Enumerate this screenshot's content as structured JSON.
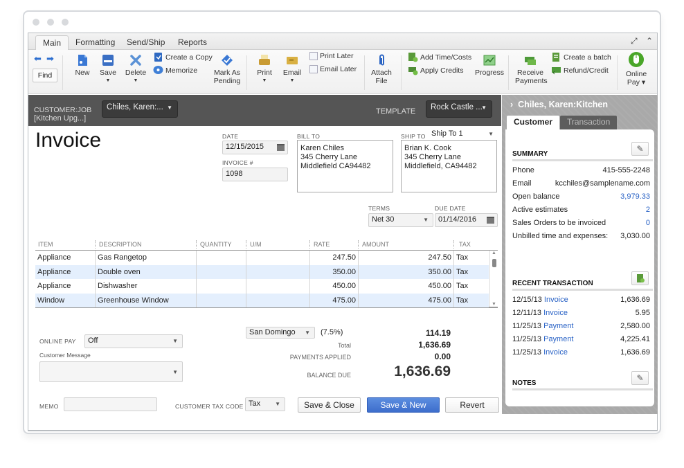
{
  "window": {
    "controls": [
      "close",
      "minimize",
      "maximize"
    ]
  },
  "tabs": [
    {
      "label": "Main",
      "active": true
    },
    {
      "label": "Formatting",
      "active": false
    },
    {
      "label": "Send/Ship",
      "active": false
    },
    {
      "label": "Reports",
      "active": false
    }
  ],
  "toolbar": {
    "find": "Find",
    "new": "New",
    "save": "Save",
    "delete": "Delete",
    "create_copy": "Create a Copy",
    "memorize": "Memorize",
    "mark_as_pending": [
      "Mark As",
      "Pending"
    ],
    "print": "Print",
    "email": "Email",
    "print_later": "Print Later",
    "email_later": "Email Later",
    "attach_file": [
      "Attach",
      "File"
    ],
    "add_time_costs": "Add Time/Costs",
    "apply_credits": "Apply Credits",
    "progress": "Progress",
    "receive_payments": [
      "Receive",
      "Payments"
    ],
    "create_batch": "Create a batch",
    "refund_credit": "Refund/Credit",
    "online_pay": [
      "Online",
      "Pay ▾"
    ]
  },
  "header": {
    "customer_job_label": "CUSTOMER:JOB",
    "customer_job_sub": "[Kitchen Upg...]",
    "customer_job_value": "Chiles, Karen:...",
    "template_label": "TEMPLATE",
    "template_value": "Rock Castle ..."
  },
  "form": {
    "title": "Invoice",
    "date_label": "DATE",
    "date": "12/15/2015",
    "invoice_no_label": "INVOICE #",
    "invoice_no": "1098",
    "bill_to_label": "BILL TO",
    "bill_to": [
      "Karen Chiles",
      "345 Cherry Lane",
      "Middlefield CA94482"
    ],
    "ship_to_label": "SHIP TO",
    "ship_to_select": "Ship To 1",
    "ship_to": [
      "Brian K. Cook",
      "345 Cherry Lane",
      "Middlefield, CA94482"
    ],
    "terms_label": "TERMS",
    "terms": "Net 30",
    "due_date_label": "DUE DATE",
    "due_date": "01/14/2016"
  },
  "table": {
    "columns": [
      "ITEM",
      "DESCRIPTION",
      "QUANTITY",
      "U/M",
      "RATE",
      "AMOUNT",
      "TAX"
    ],
    "rows": [
      {
        "item": "Appliance",
        "description": "Gas Rangetop",
        "quantity": "",
        "um": "",
        "rate": "247.50",
        "amount": "247.50",
        "tax": "Tax"
      },
      {
        "item": "Appliance",
        "description": "Double oven",
        "quantity": "",
        "um": "",
        "rate": "350.00",
        "amount": "350.00",
        "tax": "Tax"
      },
      {
        "item": "Appliance",
        "description": "Dishwasher",
        "quantity": "",
        "um": "",
        "rate": "450.00",
        "amount": "450.00",
        "tax": "Tax"
      },
      {
        "item": "Window",
        "description": "Greenhouse Window",
        "quantity": "",
        "um": "",
        "rate": "475.00",
        "amount": "475.00",
        "tax": "Tax"
      }
    ]
  },
  "footer": {
    "online_pay_label": "ONLINE PAY",
    "online_pay": "Off",
    "customer_message_label": "Customer Message",
    "customer_message": "",
    "memo_label": "MEMO",
    "memo": "",
    "tax_code_label": "CUSTOMER TAX CODE",
    "tax_code": "Tax",
    "tax_item": "San Domingo",
    "tax_rate": "(7.5%)",
    "tax_amount": "114.19",
    "total_label": "Total",
    "total": "1,636.69",
    "payments_applied_label": "PAYMENTS APPLIED",
    "payments_applied": "0.00",
    "balance_due_label": "BALANCE DUE",
    "balance_due": "1,636.69",
    "save_close": "Save & Close",
    "save_new": "Save & New",
    "revert": "Revert"
  },
  "panel": {
    "title": "Chiles, Karen:Kitchen",
    "tabs": [
      "Customer",
      "Transaction"
    ],
    "summary_title": "SUMMARY",
    "summary": [
      {
        "key": "Phone",
        "value": "415-555-2248",
        "link": false
      },
      {
        "key": "Email",
        "value": "kcchiles@samplename.com",
        "link": false
      },
      {
        "key": "Open balance",
        "value": "3,979.33",
        "link": true
      },
      {
        "key": "Active estimates",
        "value": "2",
        "link": true
      },
      {
        "key": "Sales Orders to be invoiced",
        "value": "0",
        "link": true
      },
      {
        "key": "Unbilled time and expenses:",
        "value": "3,030.00",
        "link": false
      }
    ],
    "recent_title": "RECENT TRANSACTION",
    "recent": [
      {
        "date": "12/15/13",
        "type": "Invoice",
        "amount": "1,636.69"
      },
      {
        "date": "12/11/13",
        "type": "Invoice",
        "amount": "5.95"
      },
      {
        "date": "11/25/13",
        "type": "Payment",
        "amount": "2,580.00"
      },
      {
        "date": "11/25/13",
        "type": "Payment",
        "amount": "4,225.41"
      },
      {
        "date": "11/25/13",
        "type": "Invoice",
        "amount": "1,636.69"
      }
    ],
    "notes_title": "NOTES"
  },
  "colors": {
    "accent": "#3d6dcc",
    "link": "#2a63c6",
    "header_dark": "#555555",
    "row_alt": "#e4effd"
  }
}
